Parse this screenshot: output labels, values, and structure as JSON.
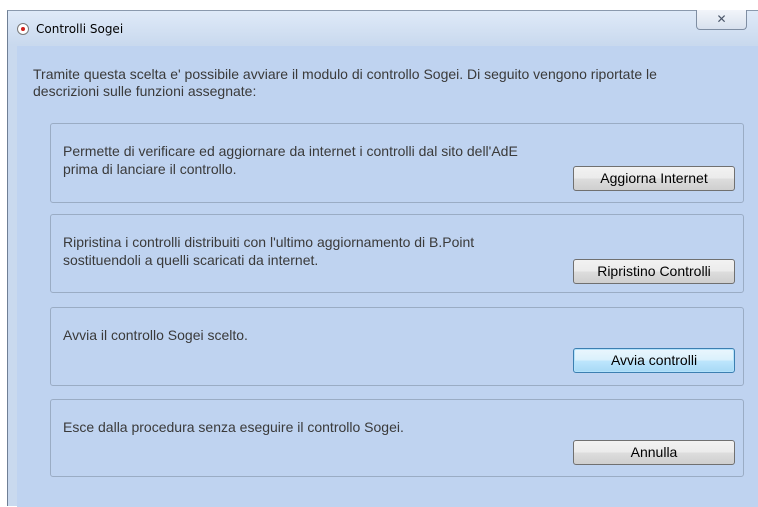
{
  "window": {
    "title": "Controlli Sogei",
    "close_glyph": "✕",
    "app_icon": "record-icon"
  },
  "intro": {
    "text": "Tramite questa scelta e' possibile avviare il modulo di controllo Sogei. Di seguito vengono riportate le descrizioni sulle funzioni assegnate:"
  },
  "groups": [
    {
      "description": "Permette di verificare ed aggiornare da internet i controlli dal sito dell'AdE prima di lanciare il controllo.",
      "button_label": "Aggiorna Internet"
    },
    {
      "description": "Ripristina i controlli distribuiti con l'ultimo aggiornamento di B.Point sostituendoli a quelli scaricati da internet.",
      "button_label": "Ripristino Controlli"
    },
    {
      "description": "Avvia il controllo Sogei scelto.",
      "button_label": "Avvia controlli"
    },
    {
      "description": "Esce dalla procedura senza eseguire il controllo Sogei.",
      "button_label": "Annulla"
    }
  ]
}
